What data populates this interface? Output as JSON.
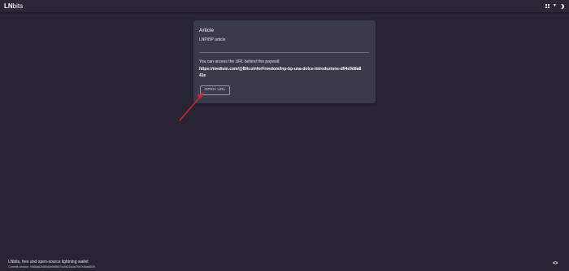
{
  "header": {
    "brand_bold": "LN",
    "brand_light": "bits",
    "icons": [
      "apps-grid-icon",
      "caret-down-icon",
      "dark-mode-moon-icon"
    ]
  },
  "card": {
    "title": "Article",
    "subtitle": "LNP/BP article",
    "description": "You can access the URL behind this paywall:",
    "url": "https://medium.com/@BitcoinforFreedom/lnp-bp-una-dolce-introduzione-d04e9d8a841e",
    "open_button": "OPEN URL"
  },
  "annotation": {
    "arrow_color": "#d9262b"
  },
  "footer": {
    "tagline": "LNbits, free and open-source lightning wallet",
    "version": "Commit version: 9968a62f489d0e59f8074c9622a4a79d7e5ab8039"
  },
  "colors": {
    "background": "#282434",
    "card": "#3a3a4a",
    "header": "#2b2737"
  }
}
